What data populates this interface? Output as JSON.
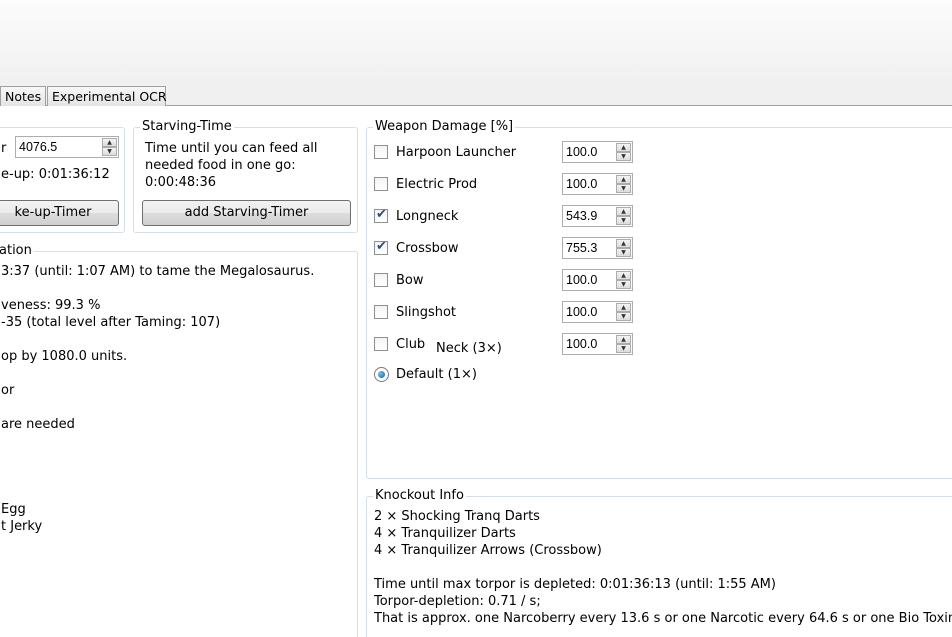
{
  "tabs": [
    "Notes",
    "Experimental OCR"
  ],
  "wakeup_group": {
    "label_fragment": "r",
    "value": "4076.5",
    "wakeup_text": "e-up: 0:01:36:12",
    "button_label": "ke-up-Timer"
  },
  "starving_group": {
    "title": "Starving-Time",
    "lines": [
      "Time until you can feed all",
      "needed food in one go:",
      "0:00:48:36"
    ],
    "button_label": "add Starving-Timer"
  },
  "taming_info": {
    "title": "ation",
    "lines": [
      "3:37 (until: 1:07 AM) to tame the Megalosaurus.",
      "",
      "veness: 99.3 %",
      "-35 (total level after Taming: 107)",
      "",
      "op by 1080.0 units.",
      "",
      " or",
      "",
      "are needed",
      "",
      "",
      "",
      "",
      " Egg",
      "t Jerky"
    ]
  },
  "weapon_damage": {
    "title": "Weapon Damage [%]",
    "weapons": [
      {
        "name": "Harpoon Launcher",
        "checked": false,
        "value": "100.0"
      },
      {
        "name": "Electric Prod",
        "checked": false,
        "value": "100.0"
      },
      {
        "name": "Longneck",
        "checked": true,
        "value": "543.9"
      },
      {
        "name": "Crossbow",
        "checked": true,
        "value": "755.3"
      },
      {
        "name": "Bow",
        "checked": false,
        "value": "100.0"
      },
      {
        "name": "Slingshot",
        "checked": false,
        "value": "100.0"
      },
      {
        "name": "Club",
        "checked": false,
        "value": "100.0"
      }
    ],
    "overlap_text": "Neck (3×)",
    "radio_label": "Default (1×)"
  },
  "knockout_info": {
    "title": "Knockout Info",
    "lines": [
      "2 × Shocking Tranq Darts",
      "4 × Tranquilizer Darts",
      "4 × Tranquilizer Arrows (Crossbow)",
      "",
      "Time until max torpor is depleted: 0:01:36:13 (until: 1:55 AM)",
      "Torpor-depletion: 0.71 / s;",
      "That is approx. one Narcoberry every 13.6 s or one Narcotic every 64.6 s or one Bio Toxin e"
    ]
  },
  "colors": {
    "accent_check": "#2b4c7e",
    "group_border": "#d5dfe5",
    "tab_border": "#a0a0a0"
  }
}
